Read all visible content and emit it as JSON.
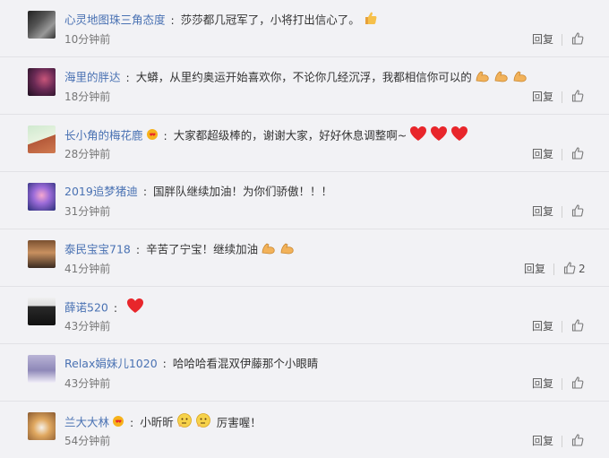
{
  "actions": {
    "reply_label": "回复",
    "thumb_icon": "thumbs-up-icon"
  },
  "colors": {
    "username": "#4a72b3",
    "background": "#f2f2f5",
    "heart": "#e8262b",
    "emoji_yellow": "#f6c04a"
  },
  "comments": [
    {
      "username": "心灵地图珠三角态度",
      "sep": ":",
      "text": "莎莎都几冠军了，小将打出信心了。",
      "emojis": [
        "thumbs-up"
      ],
      "time": "10分钟前",
      "likes": ""
    },
    {
      "username": "海里的胖达",
      "sep": ":",
      "text": "大蟒，从里约奥运开始喜欢你，不论你几经沉浮，我都相信你可以的",
      "emojis": [
        "flexed-arm",
        "flexed-arm",
        "flexed-arm"
      ],
      "time": "18分钟前",
      "likes": ""
    },
    {
      "username": "长小角的梅花鹿",
      "badge": "crown-heart-icon",
      "sep": ":",
      "text": "大家都超级棒的，谢谢大家，好好休息调整啊~",
      "emojis": [
        "heart",
        "heart",
        "heart"
      ],
      "time": "28分钟前",
      "likes": ""
    },
    {
      "username": "2019追梦猪迪",
      "sep": ":",
      "text": "国胖队继续加油！为你们骄傲！！！",
      "emojis": [],
      "time": "31分钟前",
      "likes": ""
    },
    {
      "username": "泰民宝宝718",
      "sep": ":",
      "text": "辛苦了宁宝！继续加油",
      "emojis": [
        "flexed-arm",
        "flexed-arm"
      ],
      "time": "41分钟前",
      "likes": "2"
    },
    {
      "username": "薛诺520",
      "sep": ":",
      "text": "",
      "emojis": [
        "heart"
      ],
      "time": "43分钟前",
      "likes": ""
    },
    {
      "username": "Relax娟妹儿1020",
      "sep": ":",
      "text": "哈哈哈看混双伊藤那个小眼睛",
      "emojis": [],
      "time": "43分钟前",
      "likes": ""
    },
    {
      "username": "兰大大林",
      "badge": "crown-heart-icon",
      "sep": ":",
      "text": "小昕昕",
      "emojis": [
        "thinking-face",
        "thinking-face"
      ],
      "text2": "厉害喔！",
      "time": "54分钟前",
      "likes": ""
    }
  ]
}
